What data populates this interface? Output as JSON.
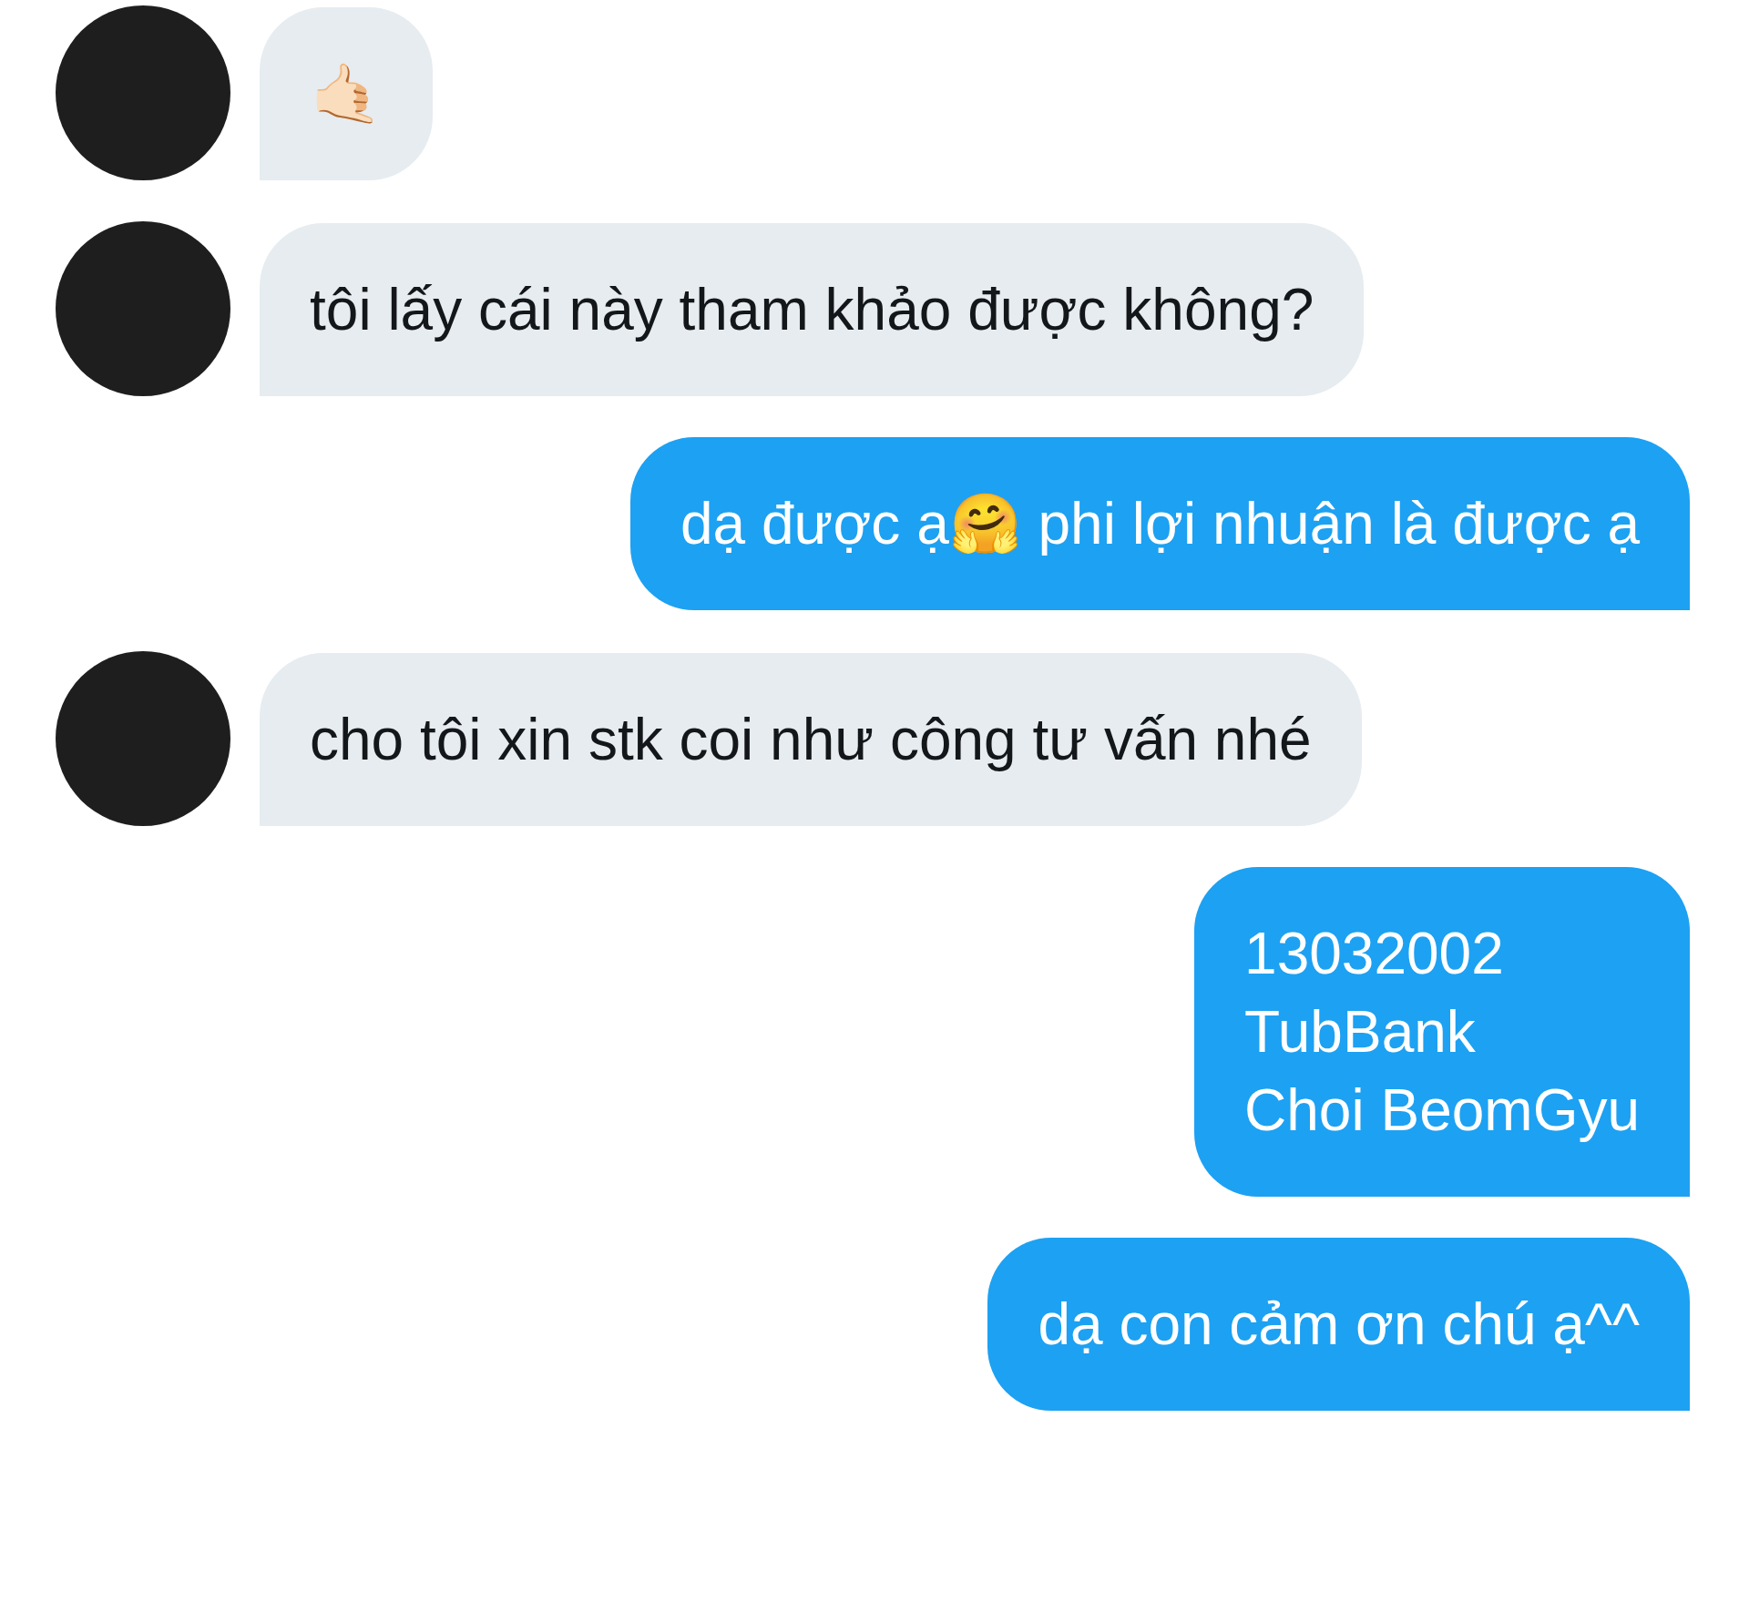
{
  "messages": [
    {
      "kind": "incoming",
      "text": "🤙🏻"
    },
    {
      "kind": "incoming",
      "text": "tôi lấy cái này tham khảo được không?"
    },
    {
      "kind": "outgoing",
      "text": "dạ được ạ🤗 phi lợi nhuận là được ạ"
    },
    {
      "kind": "incoming",
      "text": "cho tôi xin stk coi như công tư vấn nhé"
    },
    {
      "kind": "outgoing",
      "text": "13032002\nTubBank\nChoi BeomGyu"
    },
    {
      "kind": "outgoing",
      "text": "dạ con cảm ơn chú ạ^^"
    }
  ]
}
